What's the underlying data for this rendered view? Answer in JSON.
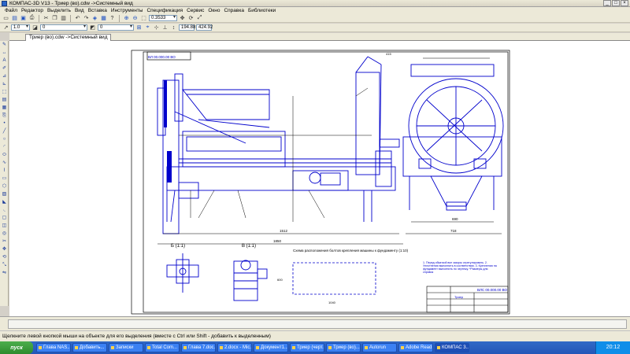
{
  "window": {
    "title": "КОМПАС-3D V13 - Триер (во).cdw ->Системный вид"
  },
  "menu": [
    "Файл",
    "Редактор",
    "Выделить",
    "Вид",
    "Вставка",
    "Инструменты",
    "Спецификация",
    "Сервис",
    "Окно",
    "Справка",
    "Библиотеки"
  ],
  "toolbar": {
    "scale": "0.3533",
    "style_value": "1.0",
    "layer_value": "0",
    "state_value": "0",
    "coord_x": "194.88",
    "coord_y": "424.92"
  },
  "document_tab": {
    "label": "Триер (во).cdw ->Системный вид"
  },
  "drawing": {
    "title_block_top": "ВЛ 00.000.00 ВО",
    "view_b": "Б (1:1)",
    "view_v": "В (1:1)",
    "scheme_title": "Схема расположения болтов крепления машины к фундаменту (1:10)",
    "notes": "1. Перед обкаткой все зазоры отрегулировать. 2. Уплотнения выполнить в соответствии. 3. Крепления на фундамент выполнить по чертежу. *Размеры для справок",
    "stamp_code": "ВЛС 00.000.00 ВО",
    "stamp_title": "Триер",
    "dims": {
      "total": "1512",
      "bottom": "1850",
      "side_a": "415",
      "scheme_w": "1040",
      "scheme_h": "600",
      "right_w": "690",
      "right_h": "718"
    }
  },
  "statusbar": {
    "hint": "Щелкните левой кнопкой мыши на объекте для его выделения (вместе с Ctrl или Shift - добавить к выделенным)"
  },
  "taskbar": {
    "start": "пуск",
    "tasks": [
      "Глава NAS...",
      "Добавить...",
      "Записки",
      "Total Com...",
      "Глава 7.doc...",
      "2.docx - Mic...",
      "Документ1...",
      "Триер (черт...",
      "Триер (во)...",
      "Autorun",
      "Adobe Read...",
      "КОМПАС 3..."
    ],
    "clock": "20:12"
  }
}
